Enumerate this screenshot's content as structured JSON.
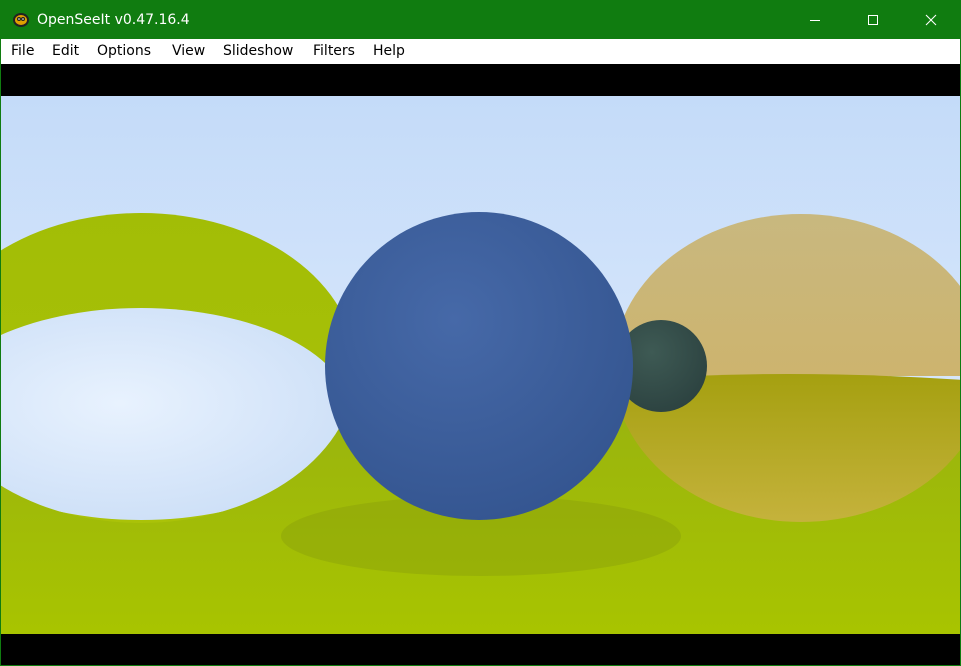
{
  "window": {
    "title": "OpenSeeIt v0.47.16.4",
    "accent_color": "#107c10",
    "controls": {
      "minimize_icon": "minimize-icon",
      "maximize_icon": "maximize-icon",
      "close_icon": "close-icon"
    }
  },
  "menubar": {
    "items": [
      {
        "label": "File"
      },
      {
        "label": "Edit"
      },
      {
        "label": "Options"
      },
      {
        "label": "View"
      },
      {
        "label": "Slideshow"
      },
      {
        "label": "Filters"
      },
      {
        "label": "Help"
      }
    ]
  },
  "image": {
    "scene": "raytraced-spheres-render",
    "colors": {
      "sky_top": "#c8defa",
      "sky_bottom": "#e8f1fc",
      "ground": "#a8c10a",
      "center_sphere": "#3e609e",
      "small_sphere": "#344c46",
      "left_sphere": "#a0c000",
      "right_sphere": "#c8b878"
    }
  }
}
